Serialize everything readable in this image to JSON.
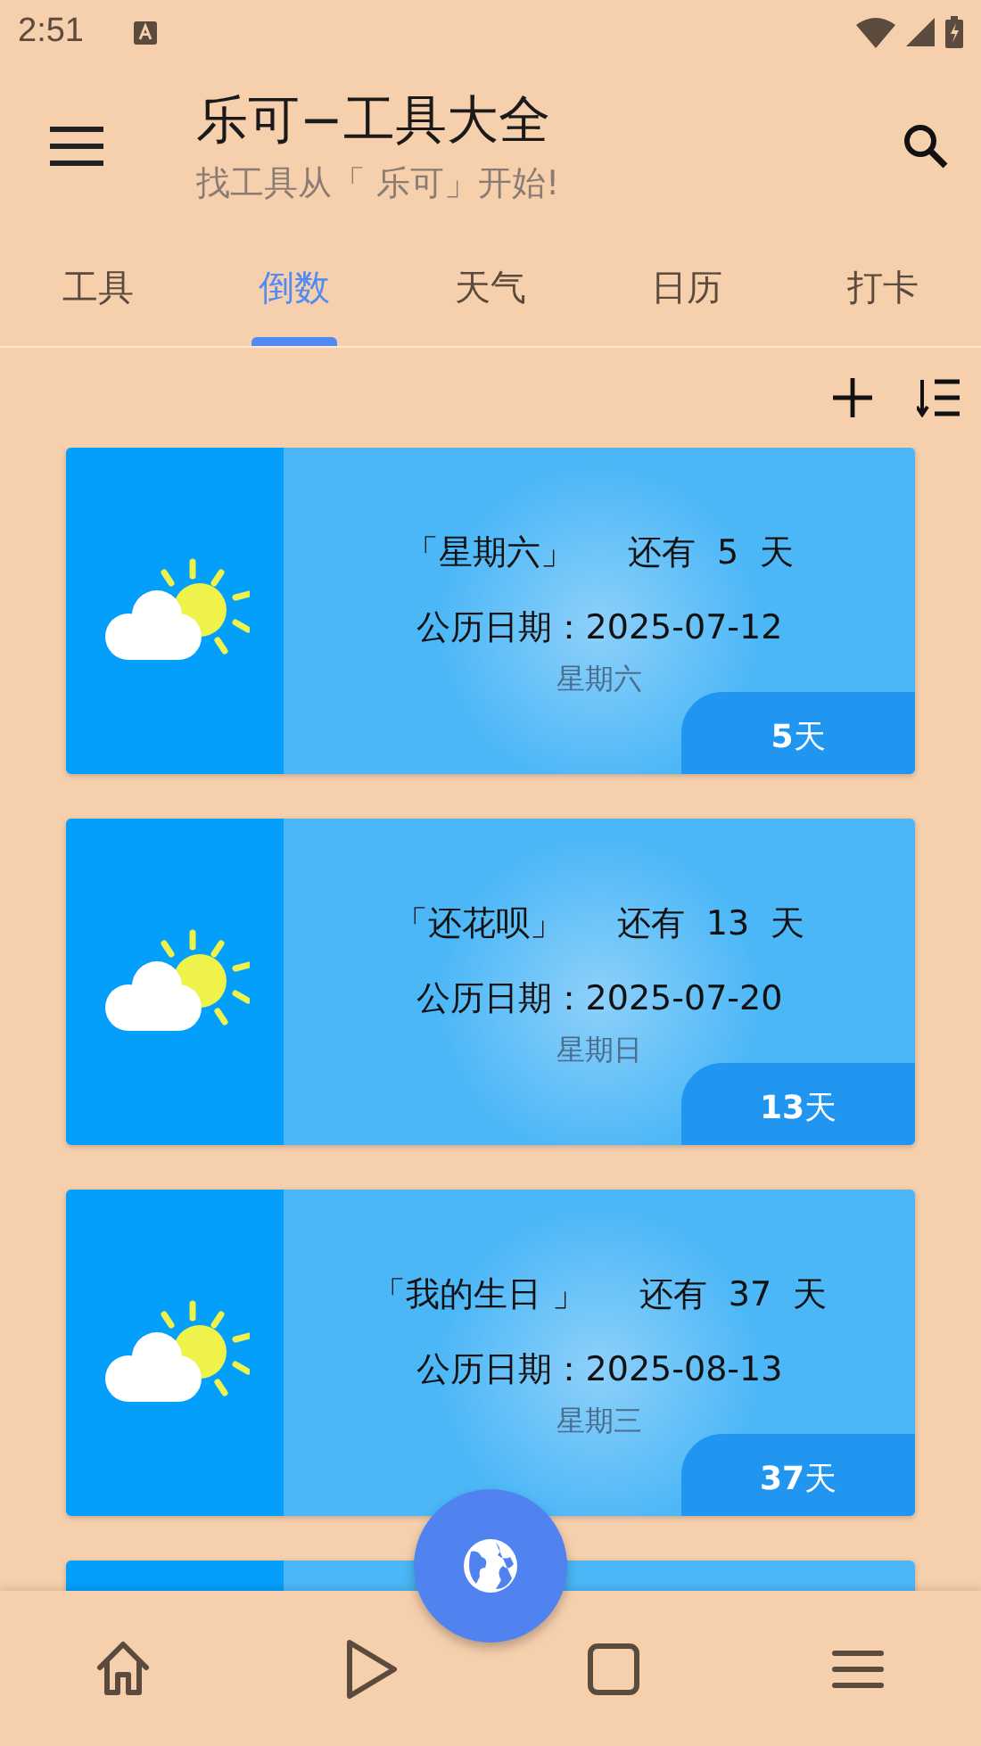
{
  "status_bar": {
    "time": "2:51"
  },
  "header": {
    "title": "乐可−工具大全",
    "subtitle": "找工具从「 乐可」开始!"
  },
  "tabs": [
    {
      "label": "工具",
      "selected": false
    },
    {
      "label": "倒数",
      "selected": true
    },
    {
      "label": "天气",
      "selected": false
    },
    {
      "label": "日历",
      "selected": false
    },
    {
      "label": "打卡",
      "selected": false
    }
  ],
  "countdowns": [
    {
      "name": "「星期六」",
      "remaining": "还有  5  天",
      "date": "公历日期：2025-07-12",
      "weekday": "星期六",
      "badge": "**5**天"
    },
    {
      "name": "「还花呗」",
      "remaining": "还有  13  天",
      "date": "公历日期：2025-07-20",
      "weekday": "星期日",
      "badge": "**13**天"
    },
    {
      "name": "「我的生日 」",
      "remaining": "还有  37  天",
      "date": "公历日期：2025-08-13",
      "weekday": "星期三",
      "badge": "**37**天"
    }
  ]
}
